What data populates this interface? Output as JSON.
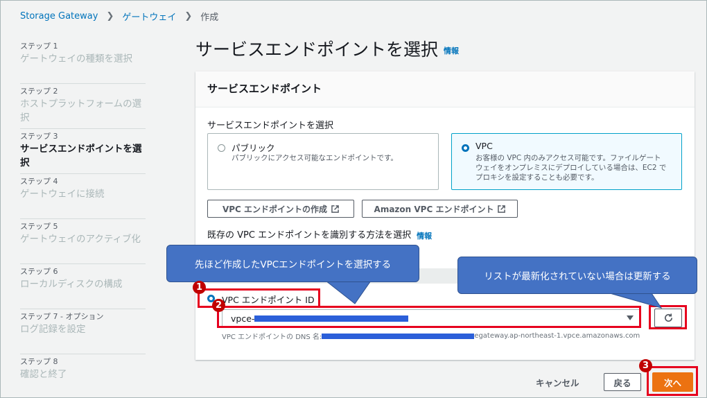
{
  "breadcrumb": {
    "items": [
      "Storage Gateway",
      "ゲートウェイ",
      "作成"
    ]
  },
  "steps": [
    {
      "num": "ステップ 1",
      "name": "ゲートウェイの種類を選択"
    },
    {
      "num": "ステップ 2",
      "name": "ホストプラットフォームの選択"
    },
    {
      "num": "ステップ 3",
      "name": "サービスエンドポイントを選択"
    },
    {
      "num": "ステップ 4",
      "name": "ゲートウェイに接続"
    },
    {
      "num": "ステップ 5",
      "name": "ゲートウェイのアクティブ化"
    },
    {
      "num": "ステップ 6",
      "name": "ローカルディスクの構成"
    },
    {
      "num": "ステップ 7 - オプション",
      "name": "ログ記録を設定"
    },
    {
      "num": "ステップ 8",
      "name": "確認と終了"
    }
  ],
  "page": {
    "title": "サービスエンドポイントを選択",
    "info": "情報"
  },
  "panel": {
    "header": "サービスエンドポイント",
    "select_label": "サービスエンドポイントを選択",
    "public": {
      "title": "パブリック",
      "desc": "パブリックにアクセス可能なエンドポイントです。"
    },
    "vpc": {
      "title": "VPC",
      "desc": [
        "お客様の VPC 内のみアクセス可能です。ファイルゲート",
        "ウェイをオンプレミスにデプロイしている場合は、EC2 で",
        "プロキシを設定することも必要です。"
      ]
    },
    "create_vpc_button": "VPC エンドポイントの作成",
    "amazon_vpc_button": "Amazon VPC エンドポイント",
    "identify_label": "既存の VPC エンドポイントを識別する方法を選択",
    "identify_info": "情報",
    "vpc_id_option": "VPC エンドポイント ID",
    "select_value_prefix": "vpce-",
    "dns_prefix": "VPC エンドポイントの DNS 名:",
    "dns_suffix": "egateway.ap-northeast-1.vpce.amazonaws.com"
  },
  "footer": {
    "cancel": "キャンセル",
    "back": "戻る",
    "next": "次へ"
  },
  "annotations": {
    "callout_left": "先ほど作成したVPCエンドポイントを選択する",
    "callout_right": "リストが最新化されていない場合は更新する",
    "badges": [
      "1",
      "2",
      "3"
    ]
  },
  "colors": {
    "primary": "#ec7211",
    "link": "#0073bb",
    "annotation_red": "#e6001e",
    "callout_blue": "#4472c4"
  }
}
